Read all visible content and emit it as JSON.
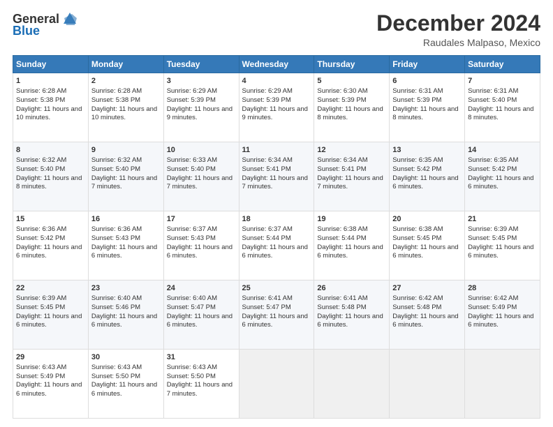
{
  "header": {
    "logo_general": "General",
    "logo_blue": "Blue",
    "month_title": "December 2024",
    "location": "Raudales Malpaso, Mexico"
  },
  "days_header": [
    "Sunday",
    "Monday",
    "Tuesday",
    "Wednesday",
    "Thursday",
    "Friday",
    "Saturday"
  ],
  "weeks": [
    [
      {
        "num": "1",
        "rise": "6:28 AM",
        "set": "5:38 PM",
        "daylight": "11 hours and 10 minutes."
      },
      {
        "num": "2",
        "rise": "6:28 AM",
        "set": "5:38 PM",
        "daylight": "11 hours and 10 minutes."
      },
      {
        "num": "3",
        "rise": "6:29 AM",
        "set": "5:39 PM",
        "daylight": "11 hours and 9 minutes."
      },
      {
        "num": "4",
        "rise": "6:29 AM",
        "set": "5:39 PM",
        "daylight": "11 hours and 9 minutes."
      },
      {
        "num": "5",
        "rise": "6:30 AM",
        "set": "5:39 PM",
        "daylight": "11 hours and 8 minutes."
      },
      {
        "num": "6",
        "rise": "6:31 AM",
        "set": "5:39 PM",
        "daylight": "11 hours and 8 minutes."
      },
      {
        "num": "7",
        "rise": "6:31 AM",
        "set": "5:40 PM",
        "daylight": "11 hours and 8 minutes."
      }
    ],
    [
      {
        "num": "8",
        "rise": "6:32 AM",
        "set": "5:40 PM",
        "daylight": "11 hours and 8 minutes."
      },
      {
        "num": "9",
        "rise": "6:32 AM",
        "set": "5:40 PM",
        "daylight": "11 hours and 7 minutes."
      },
      {
        "num": "10",
        "rise": "6:33 AM",
        "set": "5:40 PM",
        "daylight": "11 hours and 7 minutes."
      },
      {
        "num": "11",
        "rise": "6:34 AM",
        "set": "5:41 PM",
        "daylight": "11 hours and 7 minutes."
      },
      {
        "num": "12",
        "rise": "6:34 AM",
        "set": "5:41 PM",
        "daylight": "11 hours and 7 minutes."
      },
      {
        "num": "13",
        "rise": "6:35 AM",
        "set": "5:42 PM",
        "daylight": "11 hours and 6 minutes."
      },
      {
        "num": "14",
        "rise": "6:35 AM",
        "set": "5:42 PM",
        "daylight": "11 hours and 6 minutes."
      }
    ],
    [
      {
        "num": "15",
        "rise": "6:36 AM",
        "set": "5:42 PM",
        "daylight": "11 hours and 6 minutes."
      },
      {
        "num": "16",
        "rise": "6:36 AM",
        "set": "5:43 PM",
        "daylight": "11 hours and 6 minutes."
      },
      {
        "num": "17",
        "rise": "6:37 AM",
        "set": "5:43 PM",
        "daylight": "11 hours and 6 minutes."
      },
      {
        "num": "18",
        "rise": "6:37 AM",
        "set": "5:44 PM",
        "daylight": "11 hours and 6 minutes."
      },
      {
        "num": "19",
        "rise": "6:38 AM",
        "set": "5:44 PM",
        "daylight": "11 hours and 6 minutes."
      },
      {
        "num": "20",
        "rise": "6:38 AM",
        "set": "5:45 PM",
        "daylight": "11 hours and 6 minutes."
      },
      {
        "num": "21",
        "rise": "6:39 AM",
        "set": "5:45 PM",
        "daylight": "11 hours and 6 minutes."
      }
    ],
    [
      {
        "num": "22",
        "rise": "6:39 AM",
        "set": "5:45 PM",
        "daylight": "11 hours and 6 minutes."
      },
      {
        "num": "23",
        "rise": "6:40 AM",
        "set": "5:46 PM",
        "daylight": "11 hours and 6 minutes."
      },
      {
        "num": "24",
        "rise": "6:40 AM",
        "set": "5:47 PM",
        "daylight": "11 hours and 6 minutes."
      },
      {
        "num": "25",
        "rise": "6:41 AM",
        "set": "5:47 PM",
        "daylight": "11 hours and 6 minutes."
      },
      {
        "num": "26",
        "rise": "6:41 AM",
        "set": "5:48 PM",
        "daylight": "11 hours and 6 minutes."
      },
      {
        "num": "27",
        "rise": "6:42 AM",
        "set": "5:48 PM",
        "daylight": "11 hours and 6 minutes."
      },
      {
        "num": "28",
        "rise": "6:42 AM",
        "set": "5:49 PM",
        "daylight": "11 hours and 6 minutes."
      }
    ],
    [
      {
        "num": "29",
        "rise": "6:43 AM",
        "set": "5:49 PM",
        "daylight": "11 hours and 6 minutes."
      },
      {
        "num": "30",
        "rise": "6:43 AM",
        "set": "5:50 PM",
        "daylight": "11 hours and 6 minutes."
      },
      {
        "num": "31",
        "rise": "6:43 AM",
        "set": "5:50 PM",
        "daylight": "11 hours and 7 minutes."
      },
      null,
      null,
      null,
      null
    ]
  ],
  "labels": {
    "sunrise": "Sunrise:",
    "sunset": "Sunset:",
    "daylight": "Daylight:"
  }
}
